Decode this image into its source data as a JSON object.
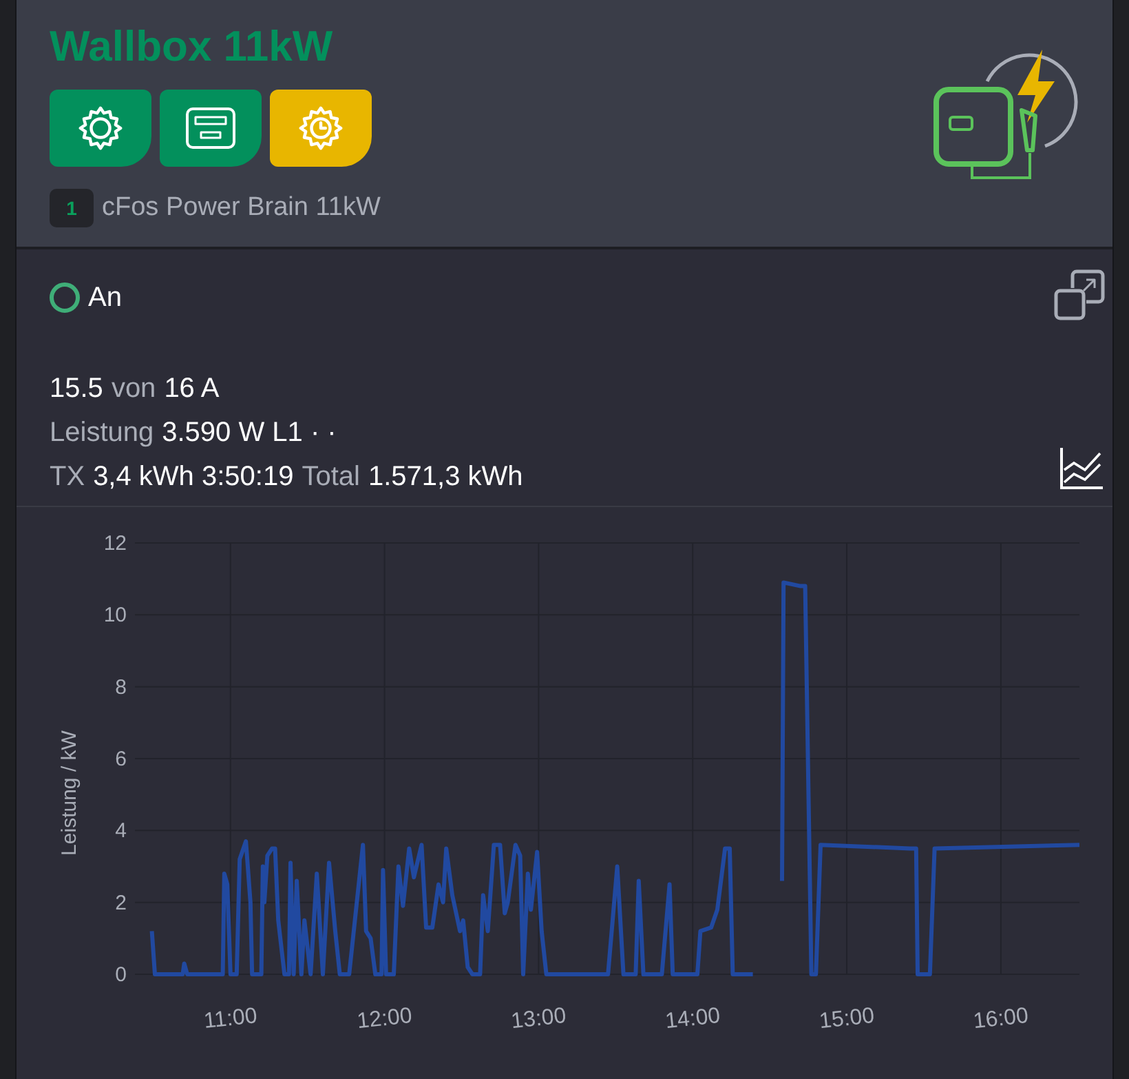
{
  "header": {
    "title": "Wallbox 11kW",
    "buttons": [
      {
        "kind": "settings",
        "color": "#03905c"
      },
      {
        "kind": "meter",
        "color": "#03905c"
      },
      {
        "kind": "schedule",
        "color": "#e8b600"
      }
    ],
    "device": {
      "badge": "1",
      "name": "cFos Power Brain 11kW"
    }
  },
  "status": {
    "label": "An",
    "on": true
  },
  "readings": [
    [
      {
        "text": "15.5",
        "muted": false
      },
      {
        "text": "von",
        "muted": true
      },
      {
        "text": "16 A",
        "muted": false
      }
    ],
    [
      {
        "text": "Leistung",
        "muted": true
      },
      {
        "text": "3.590 W L1 · ·",
        "muted": false
      }
    ],
    [
      {
        "text": "TX",
        "muted": true
      },
      {
        "text": "3,4 kWh 3:50:19",
        "muted": false
      },
      {
        "text": "Total",
        "muted": true
      },
      {
        "text": "1.571,3 kWh",
        "muted": false
      }
    ]
  ],
  "chart_data": {
    "type": "line",
    "ylabel": "Leistung / kW",
    "xlim": [
      10.38,
      16.51
    ],
    "ylim": [
      0,
      12
    ],
    "grid": true,
    "yticks": [
      0,
      2,
      4,
      6,
      8,
      10,
      12
    ],
    "xticks": [
      {
        "value": 11,
        "label": "11:00"
      },
      {
        "value": 12,
        "label": "12:00"
      },
      {
        "value": 13,
        "label": "13:00"
      },
      {
        "value": 14,
        "label": "14:00"
      },
      {
        "value": 15,
        "label": "15:00"
      },
      {
        "value": 16,
        "label": "16:00"
      }
    ],
    "x": [
      10.49,
      10.51,
      10.57,
      10.63,
      10.69,
      10.7,
      10.72,
      10.95,
      10.96,
      10.98,
      11.0,
      11.04,
      11.06,
      11.1,
      11.13,
      11.14,
      11.2,
      11.21,
      11.22,
      11.24,
      11.27,
      11.29,
      11.31,
      11.35,
      11.38,
      11.39,
      11.41,
      11.43,
      11.46,
      11.48,
      11.52,
      11.56,
      11.6,
      11.64,
      11.68,
      11.71,
      11.77,
      11.86,
      11.88,
      11.91,
      11.94,
      11.98,
      11.99,
      12.01,
      12.06,
      12.09,
      12.12,
      12.16,
      12.19,
      12.24,
      12.27,
      12.31,
      12.35,
      12.38,
      12.4,
      12.44,
      12.49,
      12.51,
      12.54,
      12.57,
      12.62,
      12.64,
      12.67,
      12.71,
      12.75,
      12.78,
      12.8,
      12.85,
      12.88,
      12.9,
      12.93,
      12.95,
      12.99,
      13.02,
      13.05,
      13.45,
      13.51,
      13.55,
      13.63,
      13.65,
      13.68,
      13.8,
      13.85,
      13.87,
      14.03,
      14.05,
      14.12,
      14.16,
      14.21,
      14.24,
      14.26,
      14.39,
      14.58,
      14.59,
      14.7,
      14.73,
      14.77,
      14.8,
      14.83,
      15.41,
      15.45,
      15.46,
      15.54,
      15.57,
      16.51
    ],
    "series": [
      {
        "color": "#2149a0",
        "values": [
          1.2,
          0,
          0,
          0,
          0,
          0.3,
          0,
          0,
          2.8,
          2.5,
          0,
          0,
          3.2,
          3.7,
          2,
          0,
          0,
          3,
          2,
          3.3,
          3.5,
          3.5,
          1.5,
          0,
          0,
          3.1,
          0,
          2.6,
          0,
          1.5,
          0,
          2.8,
          0,
          3.1,
          1.2,
          0,
          0,
          3.6,
          1.2,
          1,
          0,
          0,
          2.9,
          0,
          0,
          3,
          1.9,
          3.5,
          2.7,
          3.6,
          1.3,
          1.3,
          2.5,
          2,
          3.5,
          2.2,
          1.2,
          1.5,
          0.2,
          0,
          0,
          2.2,
          1.2,
          3.6,
          3.6,
          1.7,
          2,
          3.6,
          3.3,
          0,
          2.8,
          1.8,
          3.4,
          1.2,
          0,
          0,
          3,
          0,
          0,
          2.6,
          0,
          0,
          2.5,
          0,
          0,
          1.2,
          1.3,
          1.8,
          3.5,
          3.5,
          0,
          0,
          null,
          null,
          null,
          null,
          null,
          null,
          null,
          null,
          null,
          null,
          null,
          null,
          null
        ]
      },
      {
        "color": "#2149a0",
        "values": [
          null,
          null,
          null,
          null,
          null,
          null,
          null,
          null,
          null,
          null,
          null,
          null,
          null,
          null,
          null,
          null,
          null,
          null,
          null,
          null,
          null,
          null,
          null,
          null,
          null,
          null,
          null,
          null,
          null,
          null,
          null,
          null,
          null,
          null,
          null,
          null,
          null,
          null,
          null,
          null,
          null,
          null,
          null,
          null,
          null,
          null,
          null,
          null,
          null,
          null,
          null,
          null,
          null,
          null,
          null,
          null,
          null,
          null,
          null,
          null,
          null,
          null,
          null,
          null,
          null,
          null,
          null,
          null,
          null,
          null,
          null,
          null,
          null,
          null,
          null,
          null,
          null,
          null,
          null,
          null,
          null,
          null,
          null,
          null,
          null,
          null,
          null,
          null,
          null,
          null,
          null,
          null,
          2.6,
          10.9,
          10.8,
          10.8,
          0,
          0,
          3.6,
          3.5,
          3.5,
          0,
          0,
          3.5,
          3.6
        ]
      }
    ]
  }
}
